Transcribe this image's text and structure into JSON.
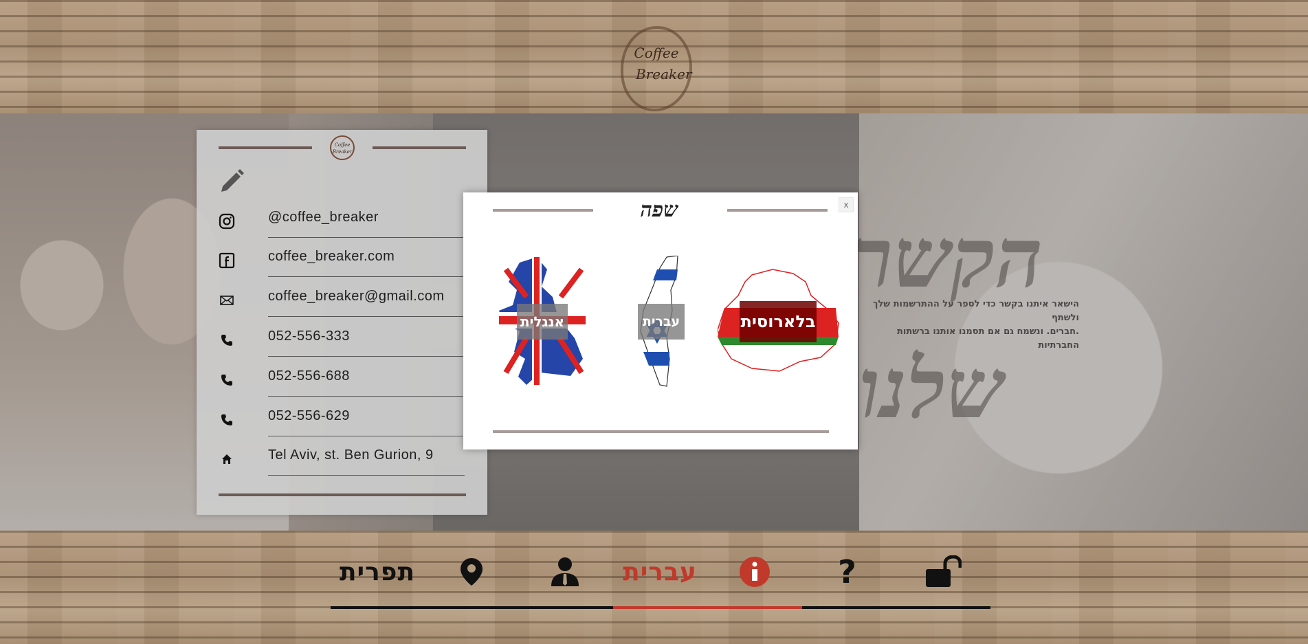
{
  "header": {
    "logo_line1": "Coffee",
    "logo_line2": "Breaker"
  },
  "hero": {
    "brush_text_1": "הקשר",
    "brush_text_2": "שלנו",
    "side_text_1": "הישאר איתנו בקשר כדי לספר על ההתרשמות שלך ולשתף",
    "side_text_2": ".חברים. ונשמח גם אם תסמנו אותנו ברשתות החברתיות"
  },
  "contact_card": {
    "logo_line1": "Coffee",
    "logo_line2": "Breaker",
    "edit_icon": "pencil-icon",
    "rows": [
      {
        "icon": "instagram-icon",
        "text": "@coffee_breaker"
      },
      {
        "icon": "facebook-icon",
        "text": "coffee_breaker.com"
      },
      {
        "icon": "mail-icon",
        "text": "coffee_breaker@gmail.com"
      },
      {
        "icon": "phone-icon",
        "text": "052-556-333"
      },
      {
        "icon": "phone-icon",
        "text": "052-556-688"
      },
      {
        "icon": "phone-icon",
        "text": "052-556-629"
      },
      {
        "icon": "home-icon",
        "text": "Tel Aviv, st. Ben Gurion, 9"
      }
    ]
  },
  "language_modal": {
    "title": "שפה",
    "close_label": "x",
    "options": [
      {
        "label": "אנגלית",
        "icon": "uk-flag-map-icon"
      },
      {
        "label": "עברית",
        "icon": "israel-flag-map-icon"
      },
      {
        "label": "בלארוסית",
        "icon": "belarus-flag-map-icon"
      }
    ]
  },
  "footer_nav": {
    "menu_label": "תפרית",
    "language_label": "עברית",
    "icons": [
      "location-pin-icon",
      "user-icon",
      "info-icon",
      "question-icon",
      "unlock-icon"
    ],
    "question_glyph": "?",
    "active_color": "#c0392b",
    "text_color": "#111111"
  }
}
